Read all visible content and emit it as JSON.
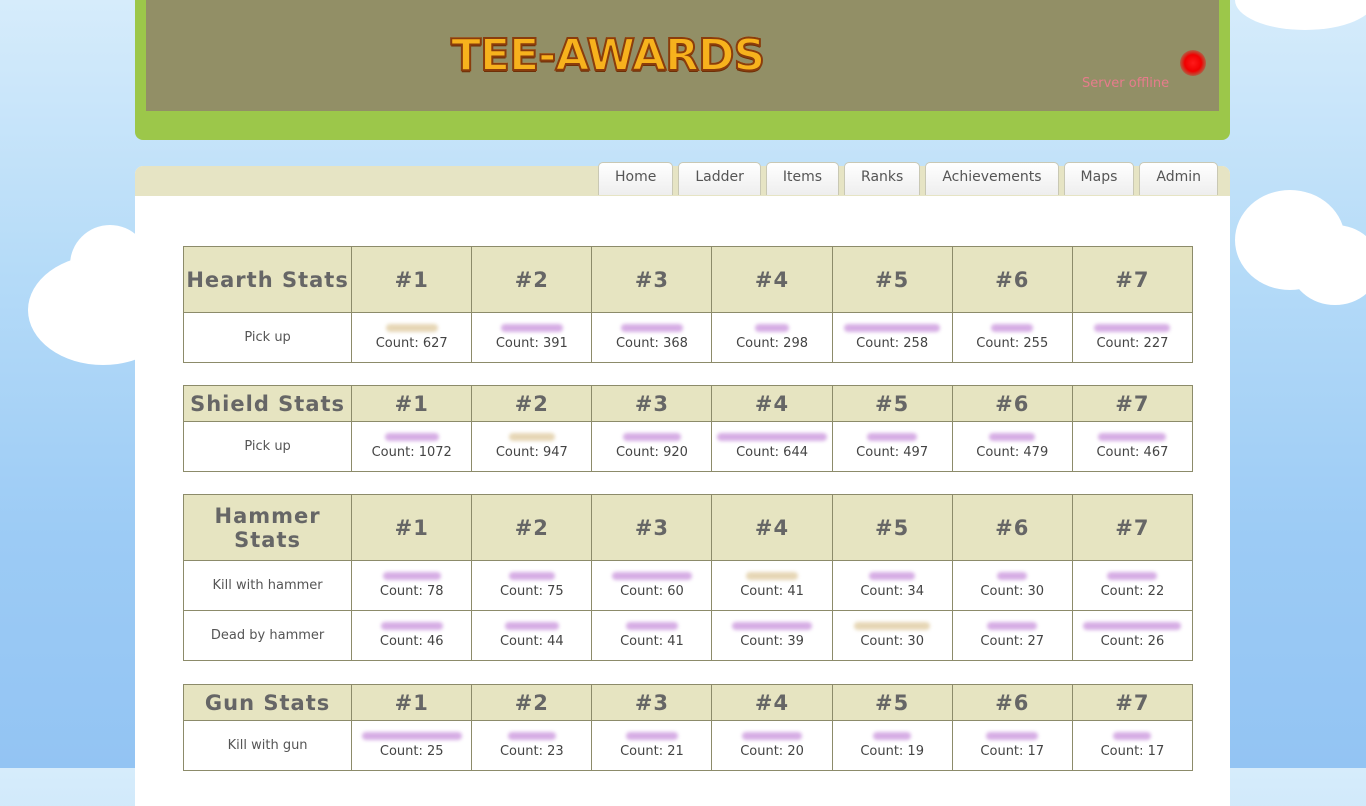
{
  "site": {
    "logo": "TEE-AWARDS",
    "server_status": "Server offline",
    "status_color": "#ff0000"
  },
  "nav": {
    "tabs": [
      "Home",
      "Ladder",
      "Items",
      "Ranks",
      "Achievements",
      "Maps",
      "Admin"
    ]
  },
  "rank_headers": [
    "#1",
    "#2",
    "#3",
    "#4",
    "#5",
    "#6",
    "#7"
  ],
  "count_prefix": "Count: ",
  "sections": [
    {
      "title": "Hearth Stats",
      "rows": [
        {
          "label": "Pick up",
          "counts": [
            627,
            391,
            368,
            298,
            258,
            255,
            227
          ],
          "name_colors": [
            "tan",
            "pink",
            "pink",
            "pink",
            "pink",
            "pink",
            "pink"
          ]
        }
      ]
    },
    {
      "title": "Shield Stats",
      "rows": [
        {
          "label": "Pick up",
          "counts": [
            1072,
            947,
            920,
            644,
            497,
            479,
            467
          ],
          "name_colors": [
            "pink",
            "tan",
            "pink",
            "pink",
            "pink",
            "pink",
            "pink"
          ]
        }
      ]
    },
    {
      "title": "Hammer Stats",
      "rows": [
        {
          "label": "Kill with hammer",
          "counts": [
            78,
            75,
            60,
            41,
            34,
            30,
            22
          ],
          "name_colors": [
            "pink",
            "pink",
            "pink",
            "tan",
            "pink",
            "pink",
            "pink"
          ]
        },
        {
          "label": "Dead by hammer",
          "counts": [
            46,
            44,
            41,
            39,
            30,
            27,
            26
          ],
          "name_colors": [
            "pink",
            "pink",
            "pink",
            "pink",
            "tan",
            "pink",
            "pink"
          ]
        }
      ]
    },
    {
      "title": "Gun Stats",
      "rows": [
        {
          "label": "Kill with gun",
          "counts": [
            25,
            23,
            21,
            20,
            19,
            17,
            17
          ],
          "name_colors": [
            "pink",
            "pink",
            "pink",
            "pink",
            "pink",
            "pink",
            "pink"
          ]
        }
      ]
    }
  ]
}
